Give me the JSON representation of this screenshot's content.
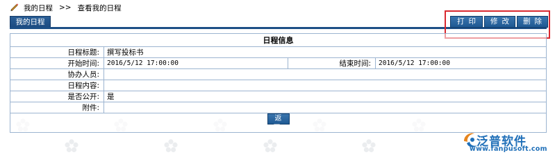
{
  "breadcrumb": {
    "items": [
      "我的日程",
      "查看我的日程"
    ],
    "separator": ">>"
  },
  "toolbar": {
    "tab_label": "我的日程",
    "print_label": "打印",
    "edit_label": "修改",
    "delete_label": "删除"
  },
  "form": {
    "title": "日程信息",
    "fields": {
      "title_label": "日程标题:",
      "title_value": "撰写投标书",
      "start_label": "开始时间:",
      "start_value": "2016/5/12 17:00:00",
      "end_label": "结束时间:",
      "end_value": "2016/5/12 17:00:00",
      "assist_label": "协办人员:",
      "assist_value": "",
      "content_label": "日程内容:",
      "content_value": "",
      "public_label": "是否公开:",
      "public_value": "是",
      "attach_label": "附件:",
      "attach_value": ""
    },
    "back_label": "返回"
  },
  "logo": {
    "name": "泛普软件",
    "url": "www.fanpusoft.com"
  },
  "colors": {
    "accent": "#1d4f86",
    "button": "#2a64a0",
    "highlight": "#d9282f",
    "border": "#9cb4d0",
    "logo": "#1f6fb8"
  }
}
